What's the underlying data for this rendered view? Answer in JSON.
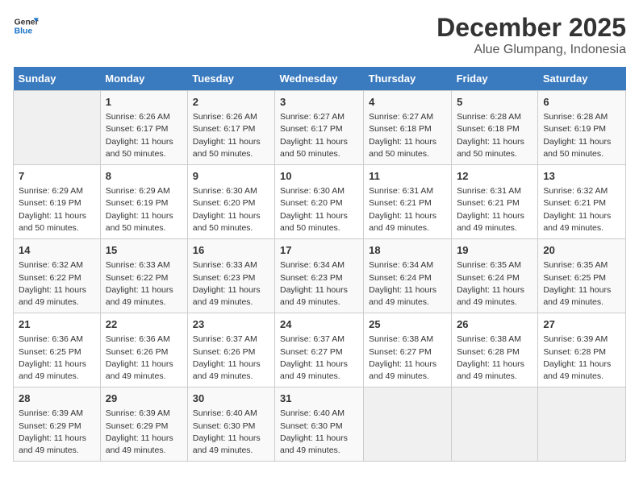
{
  "header": {
    "logo_line1": "General",
    "logo_line2": "Blue",
    "title": "December 2025",
    "subtitle": "Alue Glumpang, Indonesia"
  },
  "weekdays": [
    "Sunday",
    "Monday",
    "Tuesday",
    "Wednesday",
    "Thursday",
    "Friday",
    "Saturday"
  ],
  "weeks": [
    [
      {
        "day": "",
        "info": ""
      },
      {
        "day": "1",
        "info": "Sunrise: 6:26 AM\nSunset: 6:17 PM\nDaylight: 11 hours\nand 50 minutes."
      },
      {
        "day": "2",
        "info": "Sunrise: 6:26 AM\nSunset: 6:17 PM\nDaylight: 11 hours\nand 50 minutes."
      },
      {
        "day": "3",
        "info": "Sunrise: 6:27 AM\nSunset: 6:17 PM\nDaylight: 11 hours\nand 50 minutes."
      },
      {
        "day": "4",
        "info": "Sunrise: 6:27 AM\nSunset: 6:18 PM\nDaylight: 11 hours\nand 50 minutes."
      },
      {
        "day": "5",
        "info": "Sunrise: 6:28 AM\nSunset: 6:18 PM\nDaylight: 11 hours\nand 50 minutes."
      },
      {
        "day": "6",
        "info": "Sunrise: 6:28 AM\nSunset: 6:19 PM\nDaylight: 11 hours\nand 50 minutes."
      }
    ],
    [
      {
        "day": "7",
        "info": "Sunrise: 6:29 AM\nSunset: 6:19 PM\nDaylight: 11 hours\nand 50 minutes."
      },
      {
        "day": "8",
        "info": "Sunrise: 6:29 AM\nSunset: 6:19 PM\nDaylight: 11 hours\nand 50 minutes."
      },
      {
        "day": "9",
        "info": "Sunrise: 6:30 AM\nSunset: 6:20 PM\nDaylight: 11 hours\nand 50 minutes."
      },
      {
        "day": "10",
        "info": "Sunrise: 6:30 AM\nSunset: 6:20 PM\nDaylight: 11 hours\nand 50 minutes."
      },
      {
        "day": "11",
        "info": "Sunrise: 6:31 AM\nSunset: 6:21 PM\nDaylight: 11 hours\nand 49 minutes."
      },
      {
        "day": "12",
        "info": "Sunrise: 6:31 AM\nSunset: 6:21 PM\nDaylight: 11 hours\nand 49 minutes."
      },
      {
        "day": "13",
        "info": "Sunrise: 6:32 AM\nSunset: 6:21 PM\nDaylight: 11 hours\nand 49 minutes."
      }
    ],
    [
      {
        "day": "14",
        "info": "Sunrise: 6:32 AM\nSunset: 6:22 PM\nDaylight: 11 hours\nand 49 minutes."
      },
      {
        "day": "15",
        "info": "Sunrise: 6:33 AM\nSunset: 6:22 PM\nDaylight: 11 hours\nand 49 minutes."
      },
      {
        "day": "16",
        "info": "Sunrise: 6:33 AM\nSunset: 6:23 PM\nDaylight: 11 hours\nand 49 minutes."
      },
      {
        "day": "17",
        "info": "Sunrise: 6:34 AM\nSunset: 6:23 PM\nDaylight: 11 hours\nand 49 minutes."
      },
      {
        "day": "18",
        "info": "Sunrise: 6:34 AM\nSunset: 6:24 PM\nDaylight: 11 hours\nand 49 minutes."
      },
      {
        "day": "19",
        "info": "Sunrise: 6:35 AM\nSunset: 6:24 PM\nDaylight: 11 hours\nand 49 minutes."
      },
      {
        "day": "20",
        "info": "Sunrise: 6:35 AM\nSunset: 6:25 PM\nDaylight: 11 hours\nand 49 minutes."
      }
    ],
    [
      {
        "day": "21",
        "info": "Sunrise: 6:36 AM\nSunset: 6:25 PM\nDaylight: 11 hours\nand 49 minutes."
      },
      {
        "day": "22",
        "info": "Sunrise: 6:36 AM\nSunset: 6:26 PM\nDaylight: 11 hours\nand 49 minutes."
      },
      {
        "day": "23",
        "info": "Sunrise: 6:37 AM\nSunset: 6:26 PM\nDaylight: 11 hours\nand 49 minutes."
      },
      {
        "day": "24",
        "info": "Sunrise: 6:37 AM\nSunset: 6:27 PM\nDaylight: 11 hours\nand 49 minutes."
      },
      {
        "day": "25",
        "info": "Sunrise: 6:38 AM\nSunset: 6:27 PM\nDaylight: 11 hours\nand 49 minutes."
      },
      {
        "day": "26",
        "info": "Sunrise: 6:38 AM\nSunset: 6:28 PM\nDaylight: 11 hours\nand 49 minutes."
      },
      {
        "day": "27",
        "info": "Sunrise: 6:39 AM\nSunset: 6:28 PM\nDaylight: 11 hours\nand 49 minutes."
      }
    ],
    [
      {
        "day": "28",
        "info": "Sunrise: 6:39 AM\nSunset: 6:29 PM\nDaylight: 11 hours\nand 49 minutes."
      },
      {
        "day": "29",
        "info": "Sunrise: 6:39 AM\nSunset: 6:29 PM\nDaylight: 11 hours\nand 49 minutes."
      },
      {
        "day": "30",
        "info": "Sunrise: 6:40 AM\nSunset: 6:30 PM\nDaylight: 11 hours\nand 49 minutes."
      },
      {
        "day": "31",
        "info": "Sunrise: 6:40 AM\nSunset: 6:30 PM\nDaylight: 11 hours\nand 49 minutes."
      },
      {
        "day": "",
        "info": ""
      },
      {
        "day": "",
        "info": ""
      },
      {
        "day": "",
        "info": ""
      }
    ]
  ]
}
